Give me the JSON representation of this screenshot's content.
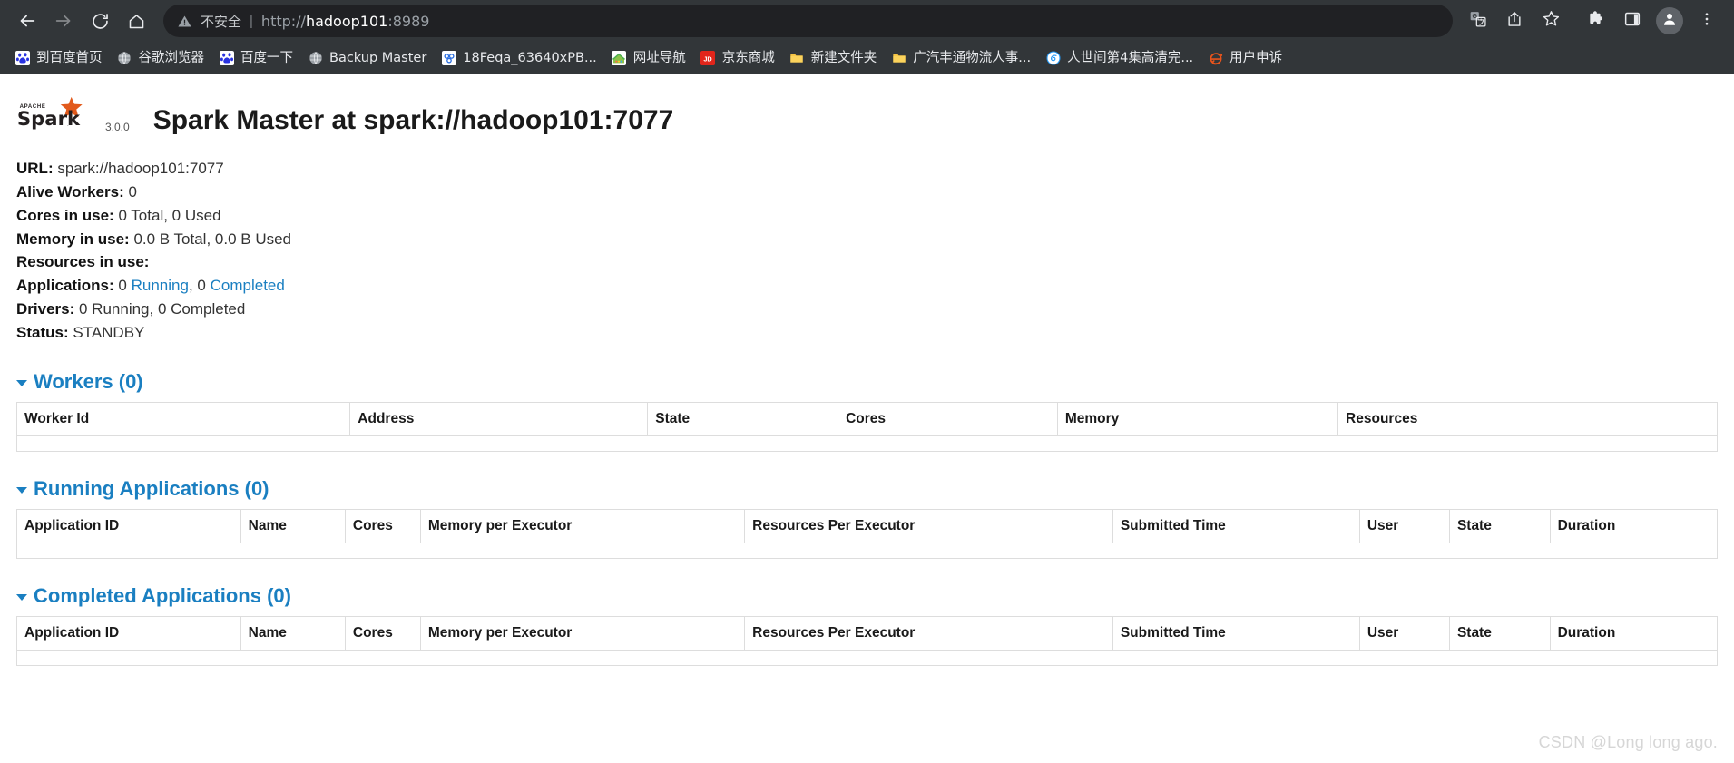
{
  "browser": {
    "nav": {
      "back": "back-arrow",
      "forward": "forward-arrow",
      "reload": "reload",
      "home": "home"
    },
    "omnibox": {
      "warning_icon": "not-secure-warning",
      "security_label": "不安全",
      "separator": "|",
      "url_scheme": "http://",
      "url_host": "hadoop101",
      "url_port": ":8989",
      "full_url": "http://hadoop101:8989"
    },
    "toolbar_icons": [
      {
        "name": "translate-icon",
        "glyph": "G"
      },
      {
        "name": "share-icon",
        "glyph": "share"
      },
      {
        "name": "bookmark-star-icon",
        "glyph": "star"
      },
      {
        "name": "extensions-puzzle-icon",
        "glyph": "puzzle"
      },
      {
        "name": "side-panel-icon",
        "glyph": "panel"
      },
      {
        "name": "profile-avatar-icon",
        "glyph": "person"
      },
      {
        "name": "chrome-menu-icon",
        "glyph": "kebab"
      }
    ],
    "bookmarks": [
      {
        "label": "到百度首页",
        "icon": "baidu-icon",
        "icon_color": "#2932e1",
        "icon_text": "百"
      },
      {
        "label": "谷歌浏览器",
        "icon": "globe-icon",
        "icon_color": "#9aa0a6",
        "icon_text": ""
      },
      {
        "label": "百度一下",
        "icon": "baidu-icon",
        "icon_color": "#2932e1",
        "icon_text": "百"
      },
      {
        "label": "Backup Master",
        "icon": "globe-icon",
        "icon_color": "#9aa0a6",
        "icon_text": ""
      },
      {
        "label": "18Feqa_63640xPB...",
        "icon": "cloud-link-icon",
        "icon_color": "#2c6fe0",
        "icon_text": ""
      },
      {
        "label": "网址导航",
        "icon": "house-nav-icon",
        "icon_color": "#4caf50",
        "icon_text": ""
      },
      {
        "label": "京东商城",
        "icon": "jd-icon",
        "icon_color": "#e1251b",
        "icon_text": "JD"
      },
      {
        "label": "新建文件夹",
        "icon": "folder-icon",
        "icon_color": "#f5c343",
        "icon_text": ""
      },
      {
        "label": "广汽丰通物流人事...",
        "icon": "folder-icon",
        "icon_color": "#f5c343",
        "icon_text": ""
      },
      {
        "label": "人世间第4集高清完...",
        "icon": "bilibili-icon",
        "icon_color": "#2196f3",
        "icon_text": ""
      },
      {
        "label": "用户申诉",
        "icon": "ie-browser-icon",
        "icon_color": "#e8541c",
        "icon_text": ""
      }
    ]
  },
  "masthead": {
    "logo_name": "apache-spark-logo",
    "logo_apache_text": "APACHE",
    "logo_word": "Spark",
    "version": "3.0.0",
    "title": "Spark Master at spark://hadoop101:7077"
  },
  "summary": {
    "url_label": "URL:",
    "url_value": "spark://hadoop101:7077",
    "alive_workers_label": "Alive Workers:",
    "alive_workers_value": "0",
    "cores_label": "Cores in use:",
    "cores_value": "0 Total, 0 Used",
    "memory_label": "Memory in use:",
    "memory_value": "0.0 B Total, 0.0 B Used",
    "resources_label": "Resources in use:",
    "resources_value": "",
    "applications_label": "Applications:",
    "applications_running_count": "0",
    "applications_running_link": "Running",
    "applications_comma": ",",
    "applications_completed_count": "0",
    "applications_completed_link": "Completed",
    "drivers_label": "Drivers:",
    "drivers_value": "0 Running, 0 Completed",
    "status_label": "Status:",
    "status_value": "STANDBY"
  },
  "sections": {
    "workers": {
      "title": "Workers (0)",
      "columns": [
        "Worker Id",
        "Address",
        "State",
        "Cores",
        "Memory",
        "Resources"
      ],
      "rows": []
    },
    "running_apps": {
      "title": "Running Applications (0)",
      "columns": [
        "Application ID",
        "Name",
        "Cores",
        "Memory per Executor",
        "Resources Per Executor",
        "Submitted Time",
        "User",
        "State",
        "Duration"
      ],
      "rows": []
    },
    "completed_apps": {
      "title": "Completed Applications (0)",
      "columns": [
        "Application ID",
        "Name",
        "Cores",
        "Memory per Executor",
        "Resources Per Executor",
        "Submitted Time",
        "User",
        "State",
        "Duration"
      ],
      "rows": []
    }
  },
  "watermark": "CSDN @Long long ago.",
  "colors": {
    "chrome_bg": "#323639",
    "omnibox_bg": "#202124",
    "link_blue": "#1a7fc1",
    "text_dark": "#1a1a1a",
    "table_border": "#dddddd"
  }
}
